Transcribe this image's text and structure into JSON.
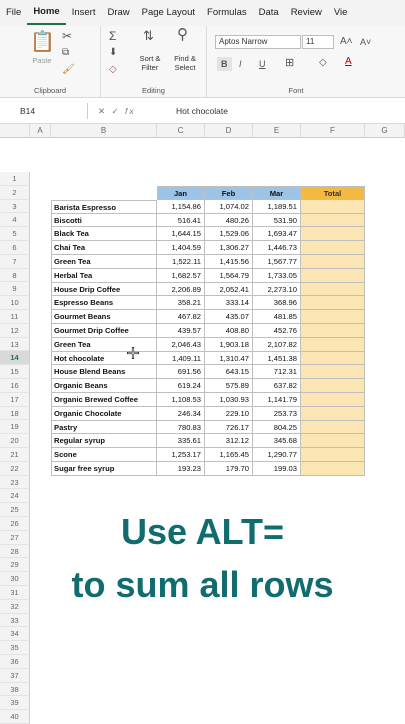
{
  "tabs": [
    "File",
    "Home",
    "Insert",
    "Draw",
    "Page Layout",
    "Formulas",
    "Data",
    "Review",
    "Vie"
  ],
  "active_tab": "Home",
  "ribbon": {
    "clipboard_label": "Clipboard",
    "paste_label": "Paste",
    "editing_label": "Editing",
    "sort_filter_label": "Sort & Filter",
    "find_select_label": "Find & Select",
    "font_label": "Font",
    "font_name": "Aptos Narrow",
    "font_size": "11",
    "bold": "B",
    "italic": "I",
    "underline": "U"
  },
  "formula_bar": {
    "name_box": "B14",
    "fx": "fx",
    "content": "Hot chocolate"
  },
  "columns": [
    "A",
    "B",
    "C",
    "D",
    "E",
    "F",
    "G"
  ],
  "rows": [
    "1",
    "2",
    "3",
    "4",
    "5",
    "6",
    "7",
    "8",
    "9",
    "10",
    "11",
    "12",
    "13",
    "14",
    "15",
    "16",
    "17",
    "18",
    "19",
    "20",
    "21",
    "22",
    "23",
    "24",
    "25",
    "26",
    "27",
    "28",
    "29",
    "30",
    "31",
    "32",
    "33",
    "34",
    "35",
    "36",
    "37",
    "38",
    "39",
    "40"
  ],
  "selected_row": "14",
  "table": {
    "headers": [
      "Jan",
      "Feb",
      "Mar",
      "Total"
    ],
    "rows": [
      {
        "name": "Barista Espresso",
        "jan": "1,154.86",
        "feb": "1,074.02",
        "mar": "1,189.51"
      },
      {
        "name": "Biscotti",
        "jan": "516.41",
        "feb": "480.26",
        "mar": "531.90"
      },
      {
        "name": "Black Tea",
        "jan": "1,644.15",
        "feb": "1,529.06",
        "mar": "1,693.47"
      },
      {
        "name": "Chai Tea",
        "jan": "1,404.59",
        "feb": "1,306.27",
        "mar": "1,446.73"
      },
      {
        "name": "Green Tea",
        "jan": "1,522.11",
        "feb": "1,415.56",
        "mar": "1,567.77"
      },
      {
        "name": "Herbal Tea",
        "jan": "1,682.57",
        "feb": "1,564.79",
        "mar": "1,733.05"
      },
      {
        "name": "House Drip Coffee",
        "jan": "2,206.89",
        "feb": "2,052.41",
        "mar": "2,273.10"
      },
      {
        "name": "Espresso Beans",
        "jan": "358.21",
        "feb": "333.14",
        "mar": "368.96"
      },
      {
        "name": "Gourmet Beans",
        "jan": "467.82",
        "feb": "435.07",
        "mar": "481.85"
      },
      {
        "name": "Gourmet Drip Coffee",
        "jan": "439.57",
        "feb": "408.80",
        "mar": "452.76"
      },
      {
        "name": "Green Tea",
        "jan": "2,046.43",
        "feb": "1,903.18",
        "mar": "2,107.82"
      },
      {
        "name": "Hot chocolate",
        "jan": "1,409.11",
        "feb": "1,310.47",
        "mar": "1,451.38"
      },
      {
        "name": "House Blend Beans",
        "jan": "691.56",
        "feb": "643.15",
        "mar": "712.31"
      },
      {
        "name": "Organic Beans",
        "jan": "619.24",
        "feb": "575.89",
        "mar": "637.82"
      },
      {
        "name": "Organic Brewed Coffee",
        "jan": "1,108.53",
        "feb": "1,030.93",
        "mar": "1,141.79"
      },
      {
        "name": "Organic Chocolate",
        "jan": "246.34",
        "feb": "229.10",
        "mar": "253.73"
      },
      {
        "name": "Pastry",
        "jan": "780.83",
        "feb": "726.17",
        "mar": "804.25"
      },
      {
        "name": "Regular syrup",
        "jan": "335.61",
        "feb": "312.12",
        "mar": "345.68"
      },
      {
        "name": "Scone",
        "jan": "1,253.17",
        "feb": "1,165.45",
        "mar": "1,290.77"
      },
      {
        "name": "Sugar free syrup",
        "jan": "193.23",
        "feb": "179.70",
        "mar": "199.03"
      }
    ]
  },
  "caption": {
    "line1": "Use ALT=",
    "line2": "to sum all rows"
  },
  "colors": {
    "header_blue": "#9dc3e6",
    "total_orange": "#f4b942",
    "total_fill": "#fbe5b3",
    "caption_teal": "#106c6e",
    "excel_green": "#1e7145"
  }
}
